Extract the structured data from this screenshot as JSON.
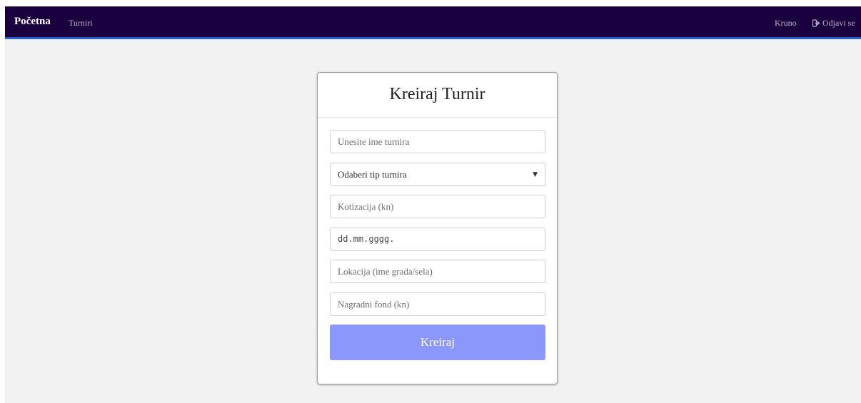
{
  "navbar": {
    "brand": "Početna",
    "links": {
      "tournaments": "Turniri"
    },
    "user": "Kruno",
    "logout_label": "Odjavi se",
    "logout_icon": "logout-icon"
  },
  "form": {
    "title": "Kreiraj Turnir",
    "name_placeholder": "Unesite ime turnira",
    "type_select": {
      "selected": "Odaberi tip turnira"
    },
    "fee_placeholder": "Kotizacija (kn)",
    "date_value": "dd.mm.gggg.",
    "location_placeholder": "Lokacija (ime grada/sela)",
    "prize_placeholder": "Nagradni fond (kn)",
    "submit_label": "Kreiraj"
  },
  "colors": {
    "navbar_bg": "#1b0040",
    "navbar_border": "#2a5fcf",
    "submit_bg": "#8c97fb",
    "page_bg": "#f2f2f2"
  }
}
